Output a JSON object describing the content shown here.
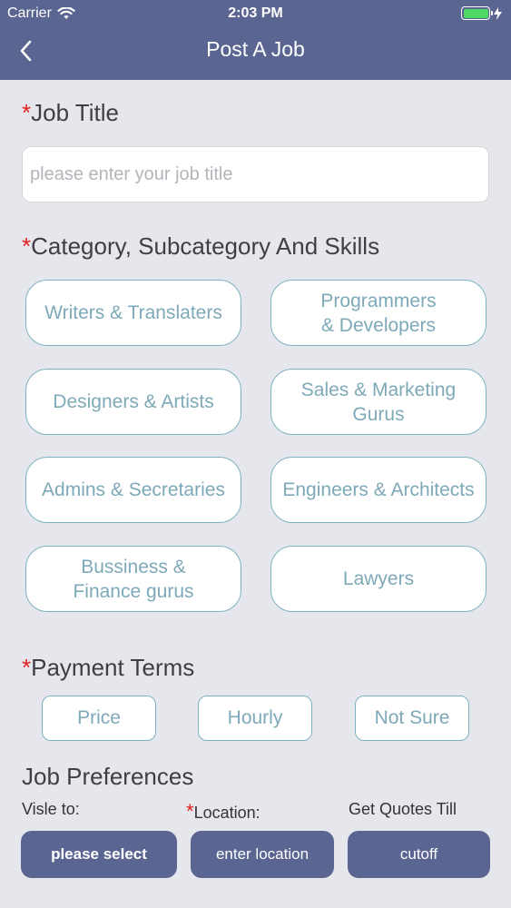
{
  "status_bar": {
    "carrier": "Carrier",
    "time": "2:03 PM"
  },
  "nav": {
    "title": "Post A Job"
  },
  "job_title": {
    "label": "Job Title",
    "placeholder": "please enter your job title"
  },
  "category": {
    "label": "Category, Subcategory And Skills",
    "items": [
      "Writers & Translaters",
      "Programmers\n& Developers",
      "Designers & Artists",
      "Sales & Marketing\nGurus",
      "Admins & Secretaries",
      "Engineers & Architects",
      "Bussiness &\nFinance gurus",
      "Lawyers"
    ]
  },
  "payment": {
    "label": "Payment Terms",
    "options": [
      "Price",
      "Hourly",
      "Not Sure"
    ]
  },
  "preferences": {
    "title": "Job Preferences",
    "visible_label": "Visle to:",
    "location_label": "Location:",
    "quotes_label": "Get Quotes Till",
    "visible_button": "please select",
    "location_button": "enter location",
    "quotes_button": "cutoff"
  },
  "required_marker": "*",
  "colors": {
    "nav_bg": "#5b6591",
    "accent_outline": "#7fb2bf",
    "required": "#e02020"
  }
}
